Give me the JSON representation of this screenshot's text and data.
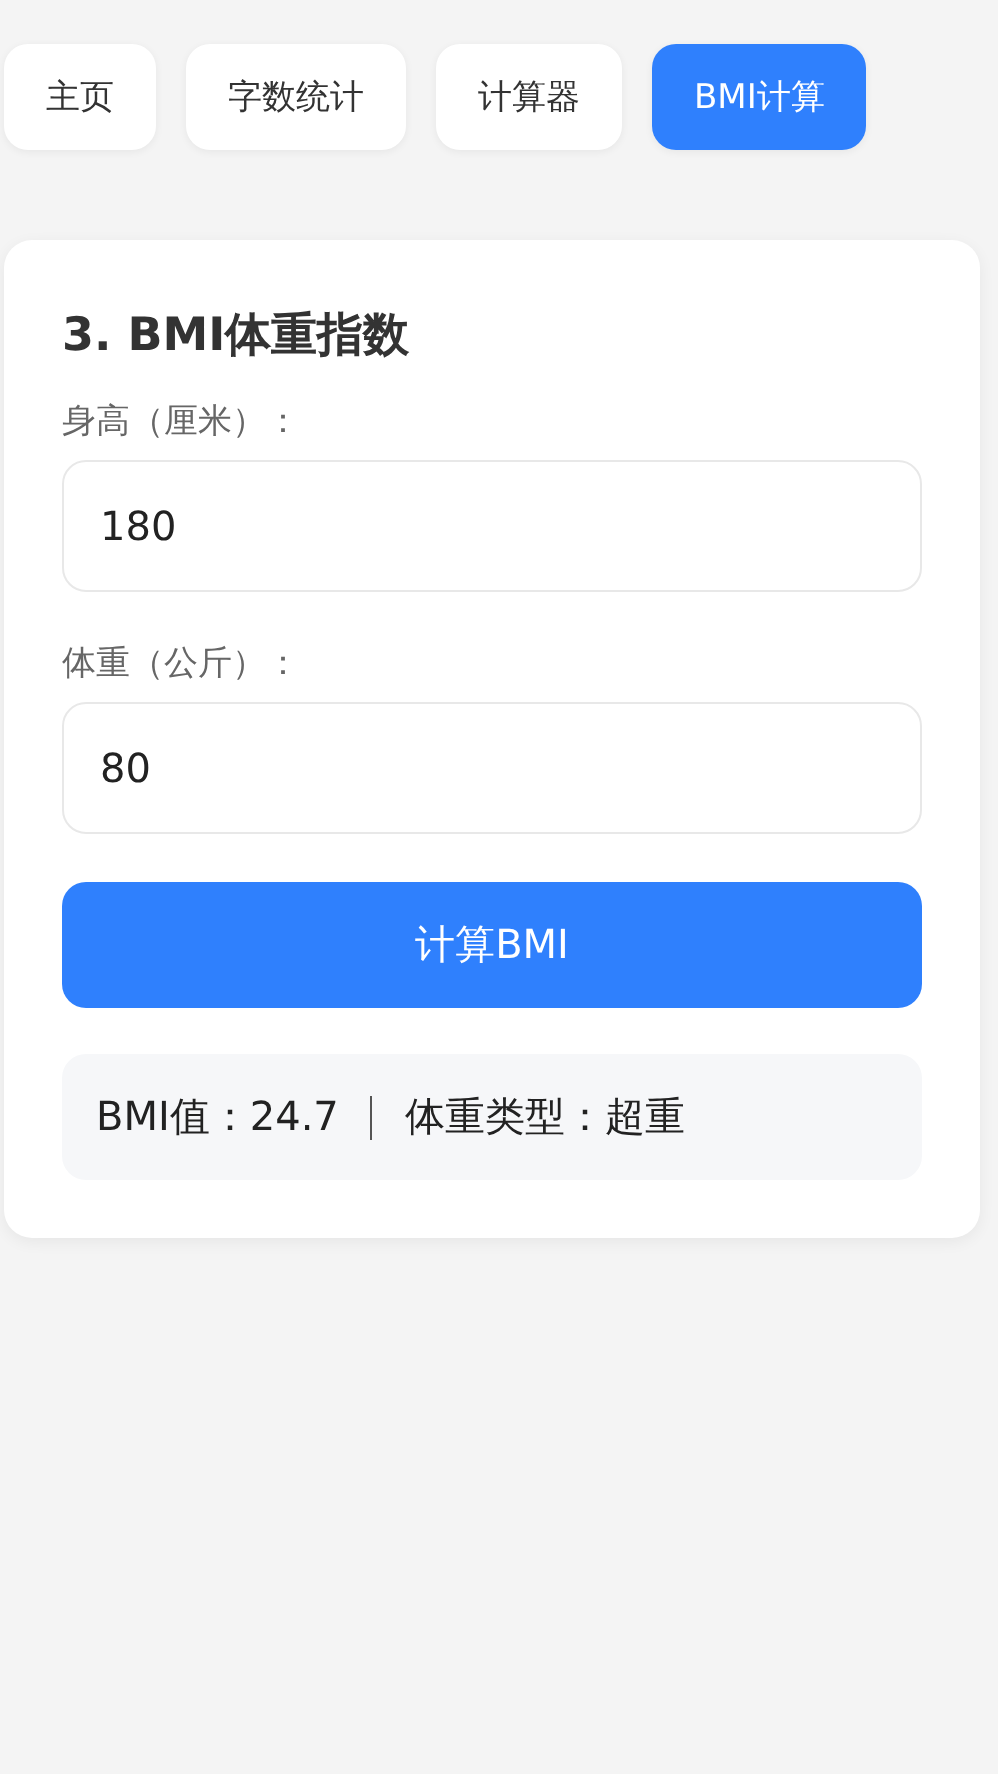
{
  "tabs": [
    {
      "label": "主页",
      "selected": false
    },
    {
      "label": "字数统计",
      "selected": false
    },
    {
      "label": "计算器",
      "selected": false
    },
    {
      "label": "BMI计算",
      "selected": true
    }
  ],
  "card": {
    "title": "3. BMI体重指数",
    "fields": [
      {
        "label": "身高（厘米）：",
        "value": "180"
      },
      {
        "label": "体重（公斤）：",
        "value": "80"
      }
    ],
    "button": "计算BMI",
    "result": {
      "bmi": "BMI值：24.7",
      "category": "体重类型：超重"
    }
  }
}
